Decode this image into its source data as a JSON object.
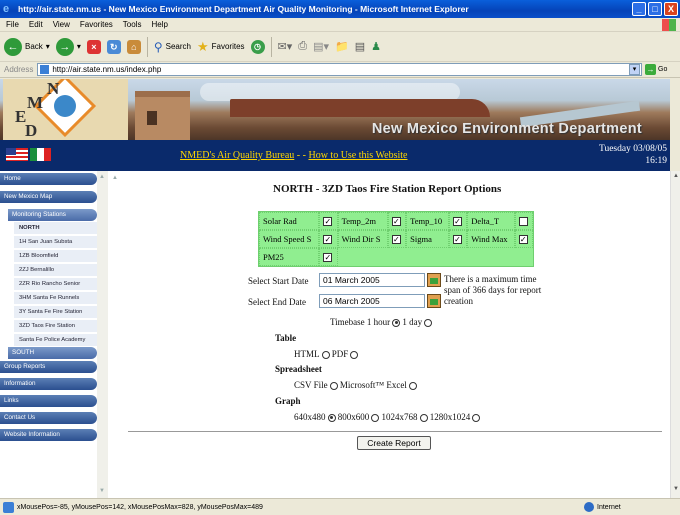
{
  "window": {
    "title": "http://air.state.nm.us - New Mexico Environment Department Air Quality Monitoring - Microsoft Internet Explorer",
    "minimize": "_",
    "maximize": "□",
    "close": "X"
  },
  "menu": [
    "File",
    "Edit",
    "View",
    "Favorites",
    "Tools",
    "Help"
  ],
  "toolbar": {
    "back": "Back",
    "search": "Search",
    "favorites": "Favorites"
  },
  "address": {
    "label": "Address",
    "url": "http://air.state.nm.us/index.php",
    "go": "Go"
  },
  "banner": {
    "logo_letters": [
      "N",
      "M",
      "E",
      "D"
    ],
    "title": "New Mexico Environment Department"
  },
  "navstrip": {
    "link1": "NMED's Air Quality Bureau",
    "separator": " - - ",
    "link2": "How to Use this Website",
    "date": "Tuesday 03/08/05",
    "time": "16:19"
  },
  "leftnav": {
    "home": "Home",
    "map": "New Mexico Map",
    "monitoring": "Monitoring Stations",
    "north": "NORTH",
    "stations": [
      "1H San Juan Substa",
      "1ZB Bloomfield",
      "2ZJ Bernalillo",
      "2ZR Rio Rancho Senior",
      "3HM Santa Fe Runnels",
      "3Y Santa Fe Fire Station",
      "3ZD Taos Fire Station",
      "Santa Fe Police Academy"
    ],
    "south": "SOUTH",
    "group_reports": "Group Reports",
    "information": "Information",
    "links": "Links",
    "contact": "Contact Us",
    "website_info": "Website Information"
  },
  "report": {
    "title": "NORTH - 3ZD Taos Fire Station Report Options",
    "params": [
      [
        "Solar Rad",
        "Temp_2m",
        "Temp_10",
        "Delta_T"
      ],
      [
        "Wind Speed S",
        "Wind Dir S",
        "Sigma",
        "Wind Max"
      ],
      [
        "PM25"
      ]
    ],
    "param_checked": [
      [
        true,
        true,
        true,
        false
      ],
      [
        true,
        true,
        true,
        true
      ],
      [
        true
      ]
    ],
    "start_label": "Select Start Date",
    "start_value": "01 March 2005",
    "end_label": "Select End Date",
    "end_value": "06 March 2005",
    "note": "There is a maximum time span of 366 days for report creation",
    "timebase_label": "Timebase",
    "timebase_opts": [
      "1 hour",
      "1 day"
    ],
    "timebase_selected": 0,
    "table_head": "Table",
    "table_opts": [
      "HTML",
      "PDF"
    ],
    "spread_head": "Spreadsheet",
    "spread_opts": [
      "CSV File",
      "Microsoft™ Excel"
    ],
    "graph_head": "Graph",
    "graph_opts": [
      "640x480",
      "800x600",
      "1024x768",
      "1280x1024"
    ],
    "graph_selected": 0,
    "button": "Create Report"
  },
  "status": {
    "text": "xMousePos=-85, yMousePos=142, xMousePosMax=828, yMousePosMax=489",
    "zone": "Internet"
  }
}
